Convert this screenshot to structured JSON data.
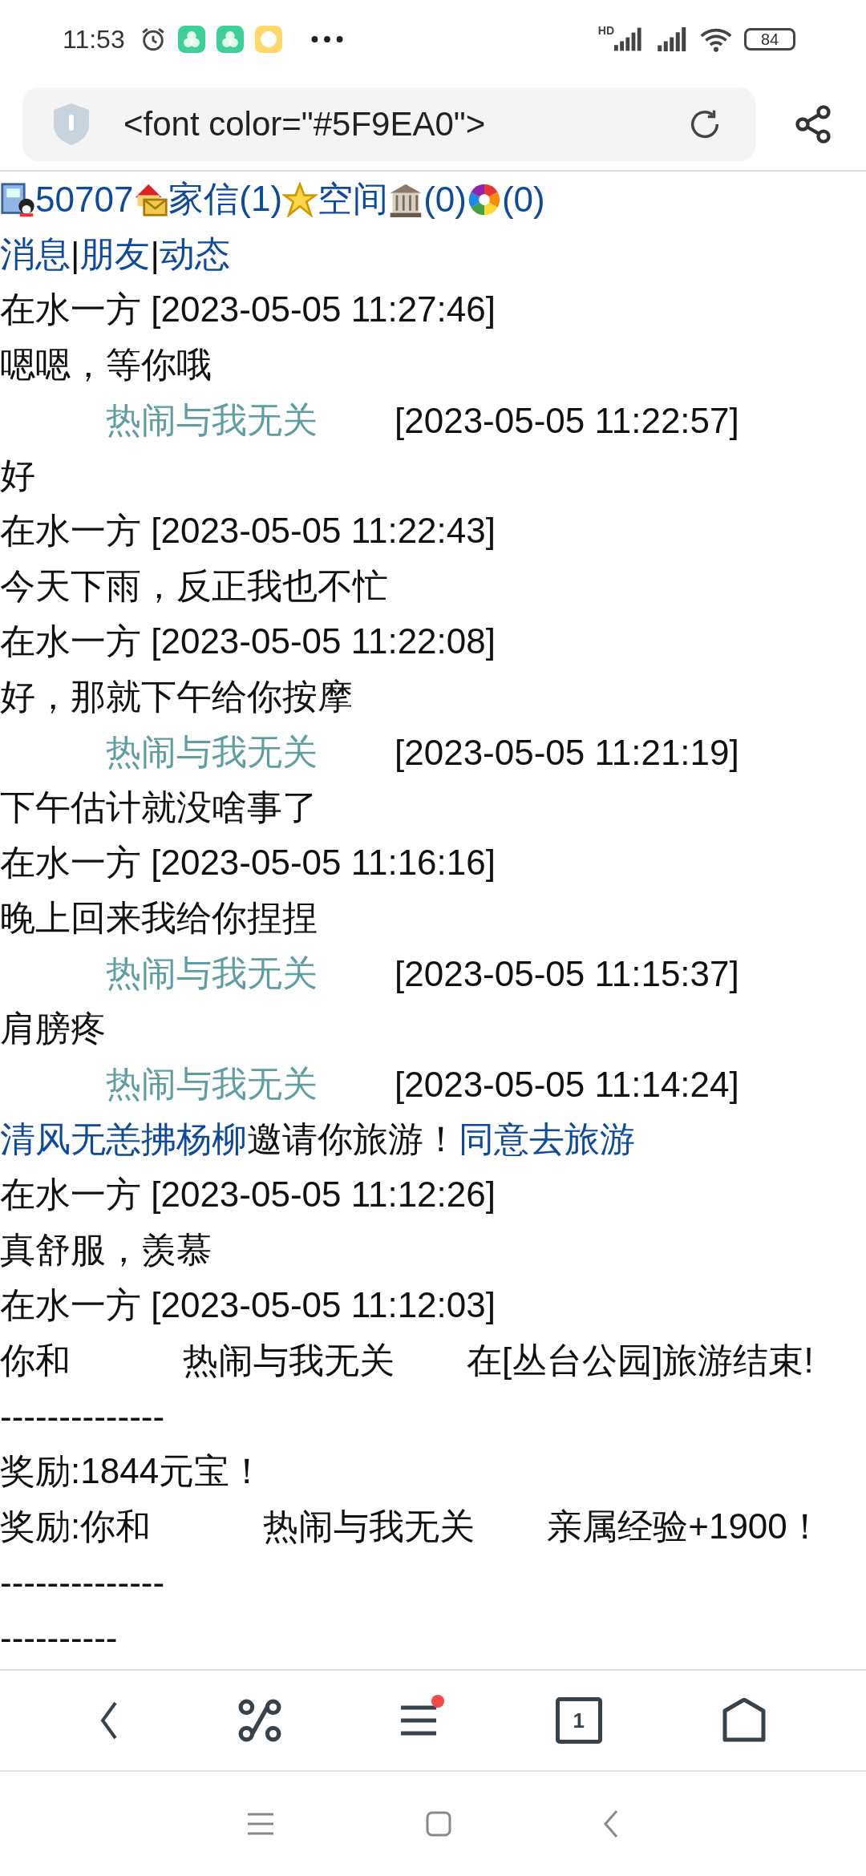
{
  "status_bar": {
    "time": "11:53",
    "network_label": "HD",
    "battery": "84"
  },
  "address_bar": {
    "url": "<font color=\"#5F9EA0\">"
  },
  "top_links": [
    {
      "text": "50707"
    },
    {
      "text": "家信(1)"
    },
    {
      "text": "空间"
    },
    {
      "text": "(0)"
    },
    {
      "text": "(0)"
    }
  ],
  "lines": [
    {
      "segments": [
        {
          "kind": "link",
          "text": "消息"
        },
        {
          "kind": "plain",
          "text": "|"
        },
        {
          "kind": "link",
          "text": "朋友"
        },
        {
          "kind": "plain",
          "text": "|"
        },
        {
          "kind": "link",
          "text": "动态"
        }
      ]
    },
    {
      "segments": [
        {
          "kind": "plain",
          "text": "在水一方 [2023-05-05 11:27:46]"
        }
      ]
    },
    {
      "segments": [
        {
          "kind": "plain",
          "text": "嗯嗯，等你哦"
        }
      ]
    },
    {
      "segments": [
        {
          "kind": "teal",
          "text": "热闹与我无关"
        },
        {
          "kind": "plain",
          "text": "[2023-05-05 11:22:57]"
        }
      ]
    },
    {
      "segments": [
        {
          "kind": "plain",
          "text": "好"
        }
      ]
    },
    {
      "segments": [
        {
          "kind": "plain",
          "text": "在水一方 [2023-05-05 11:22:43]"
        }
      ]
    },
    {
      "segments": [
        {
          "kind": "plain",
          "text": "今天下雨，反正我也不忙"
        }
      ]
    },
    {
      "segments": [
        {
          "kind": "plain",
          "text": "在水一方 [2023-05-05 11:22:08]"
        }
      ]
    },
    {
      "segments": [
        {
          "kind": "plain",
          "text": "好，那就下午给你按摩"
        }
      ]
    },
    {
      "segments": [
        {
          "kind": "teal",
          "text": "热闹与我无关"
        },
        {
          "kind": "plain",
          "text": "[2023-05-05 11:21:19]"
        }
      ]
    },
    {
      "segments": [
        {
          "kind": "plain",
          "text": "下午估计就没啥事了"
        }
      ]
    },
    {
      "segments": [
        {
          "kind": "plain",
          "text": "在水一方 [2023-05-05 11:16:16]"
        }
      ]
    },
    {
      "segments": [
        {
          "kind": "plain",
          "text": "晚上回来我给你捏捏"
        }
      ]
    },
    {
      "segments": [
        {
          "kind": "teal",
          "text": "热闹与我无关"
        },
        {
          "kind": "plain",
          "text": "[2023-05-05 11:15:37]"
        }
      ]
    },
    {
      "segments": [
        {
          "kind": "plain",
          "text": "肩膀疼"
        }
      ]
    },
    {
      "segments": [
        {
          "kind": "teal",
          "text": "热闹与我无关"
        },
        {
          "kind": "plain",
          "text": "[2023-05-05 11:14:24]"
        }
      ]
    },
    {
      "segments": [
        {
          "kind": "link",
          "text": "清风无恙拂杨柳"
        },
        {
          "kind": "plain",
          "text": "邀请你旅游！"
        },
        {
          "kind": "link",
          "text": "同意去旅游"
        }
      ]
    },
    {
      "segments": [
        {
          "kind": "plain",
          "text": "在水一方 [2023-05-05 11:12:26]"
        }
      ]
    },
    {
      "segments": [
        {
          "kind": "plain",
          "text": "真舒服，羡慕"
        }
      ]
    },
    {
      "segments": [
        {
          "kind": "plain",
          "text": "在水一方 [2023-05-05 11:12:03]"
        }
      ]
    },
    {
      "segments": [
        {
          "kind": "plain",
          "text": "你和"
        },
        {
          "kind": "name",
          "text": "热闹与我无关"
        },
        {
          "kind": "plain",
          "text": "在[丛台公园]旅游结束!"
        }
      ]
    },
    {
      "segments": [
        {
          "kind": "plain",
          "text": "--------------"
        }
      ]
    },
    {
      "segments": [
        {
          "kind": "plain",
          "text": "奖励:1844元宝！"
        }
      ]
    },
    {
      "segments": [
        {
          "kind": "plain",
          "text": "奖励:你和"
        },
        {
          "kind": "name",
          "text": "热闹与我无关"
        },
        {
          "kind": "plain",
          "text": "亲属经验+1900！"
        }
      ]
    },
    {
      "segments": [
        {
          "kind": "plain",
          "text": "--------------"
        }
      ]
    },
    {
      "segments": [
        {
          "kind": "plain",
          "text": "----------"
        }
      ]
    }
  ],
  "bottom_bar": {
    "tab_count": "1",
    "menu_notification": true
  }
}
